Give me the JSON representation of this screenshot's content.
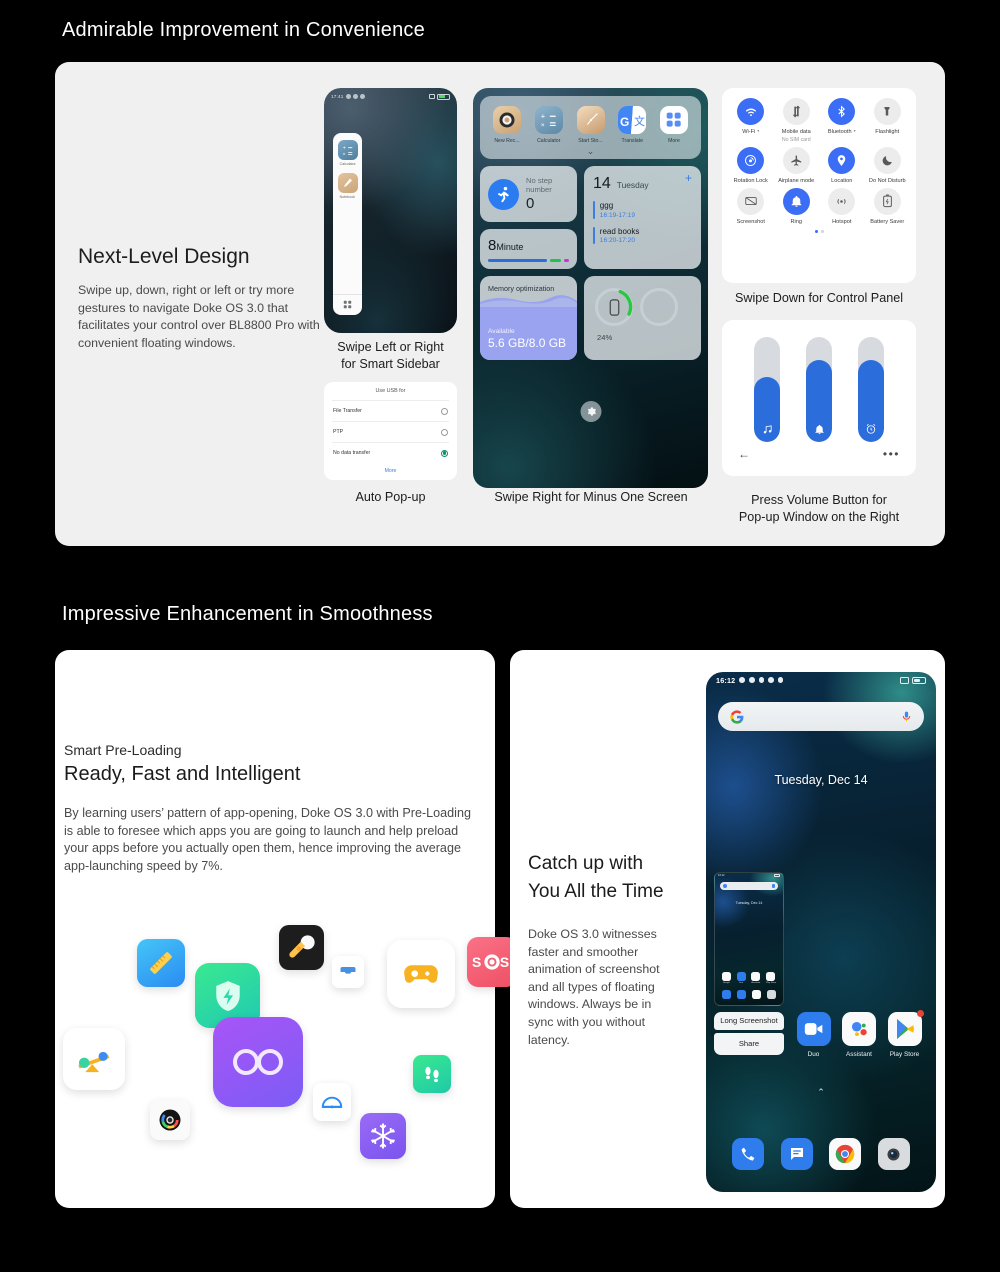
{
  "sections": {
    "one_title": "Admirable Improvement in Convenience",
    "two_title": "Impressive Enhancement in Smoothness"
  },
  "design": {
    "heading": "Next-Level Design",
    "body": "Swipe up, down, right or left or try more gestures to navigate Doke OS 3.0 that facilitates your control over BL8800 Pro with convenient floating windows."
  },
  "captions": {
    "sidebar": "Swipe Left or Right\nfor Smart Sidebar",
    "sidebar_l1": "Swipe Left or Right",
    "sidebar_l2": "for Smart Sidebar",
    "autopopup": "Auto Pop-up",
    "minus_one": "Swipe Right for Minus One Screen",
    "control_panel": "Swipe Down for Control Panel",
    "volume_l1": "Press Volume Button for",
    "volume_l2": "Pop-up Window on the Right"
  },
  "smart_sidebar": {
    "items": [
      {
        "label": "Calculator",
        "icon": "calculator-icon"
      },
      {
        "label": "Notebook",
        "icon": "notebook-icon"
      }
    ],
    "grid_icon": "app-grid-icon"
  },
  "usb_dialog": {
    "title": "Use USB for",
    "options": [
      {
        "label": "File Transfer",
        "selected": false
      },
      {
        "label": "PTP",
        "selected": false
      },
      {
        "label": "No data transfer",
        "selected": true
      }
    ],
    "more": "More"
  },
  "minus_one": {
    "apps": [
      {
        "label": "New Rec...",
        "icon": "recorder-icon"
      },
      {
        "label": "Calculator",
        "icon": "calculator-icon"
      },
      {
        "label": "Start Sto...",
        "icon": "stopwatch-icon"
      },
      {
        "label": "Translate",
        "icon": "translate-icon"
      },
      {
        "label": "More",
        "icon": "more-grid-icon"
      }
    ],
    "steps_widget": {
      "title": "No step number",
      "value": "0",
      "icon": "runner-icon"
    },
    "minute_widget": {
      "value": "8",
      "unit": "Minute"
    },
    "calendar_widget": {
      "day": "14",
      "weekday": "Tuesday",
      "add": "+",
      "events": [
        {
          "title": "ggg",
          "time": "16:19-17:19"
        },
        {
          "title": "read books",
          "time": "16:20-17:20"
        }
      ]
    },
    "memory_widget": {
      "title": "Memory optimization",
      "sub": "Available",
      "value": "5.6 GB/8.0 GB"
    },
    "battery_widget": {
      "percent": "24%",
      "icon": "battery-ring-icon"
    },
    "settings_icon": "gear-icon"
  },
  "control_panel": {
    "tiles": [
      {
        "label": "Wi-Fi",
        "sub": "",
        "on": true,
        "caret": true,
        "icon": "wifi-icon"
      },
      {
        "label": "Mobile data",
        "sub": "No SIM card",
        "on": false,
        "caret": false,
        "icon": "mobile-data-icon"
      },
      {
        "label": "Bluetooth",
        "sub": "",
        "on": true,
        "caret": true,
        "icon": "bluetooth-icon"
      },
      {
        "label": "Flashlight",
        "sub": "",
        "on": false,
        "caret": false,
        "icon": "flashlight-icon"
      },
      {
        "label": "Rotation Lock",
        "sub": "",
        "on": true,
        "caret": false,
        "icon": "rotation-lock-icon"
      },
      {
        "label": "Airplane mode",
        "sub": "",
        "on": false,
        "caret": false,
        "icon": "airplane-icon"
      },
      {
        "label": "Location",
        "sub": "",
        "on": true,
        "caret": false,
        "icon": "location-pin-icon"
      },
      {
        "label": "Do Not Disturb",
        "sub": "",
        "on": false,
        "caret": false,
        "icon": "moon-icon"
      },
      {
        "label": "Screenshot",
        "sub": "",
        "on": false,
        "caret": false,
        "icon": "screenshot-icon"
      },
      {
        "label": "Ring",
        "sub": "",
        "on": true,
        "caret": false,
        "icon": "bell-icon"
      },
      {
        "label": "Hotspot",
        "sub": "",
        "on": false,
        "caret": false,
        "icon": "hotspot-icon"
      },
      {
        "label": "Battery Saver",
        "sub": "",
        "on": false,
        "caret": false,
        "icon": "battery-saver-icon"
      }
    ]
  },
  "volume_panel": {
    "sliders": [
      {
        "name": "media",
        "icon": "music-note-icon",
        "fill_pct": 62
      },
      {
        "name": "ring",
        "icon": "bell-icon",
        "fill_pct": 78
      },
      {
        "name": "alarm",
        "icon": "alarm-clock-icon",
        "fill_pct": 78
      }
    ],
    "back_icon": "back-arrow-icon",
    "more_icon": "more-dots-icon"
  },
  "preloading": {
    "eyebrow": "Smart Pre-Loading",
    "heading": "Ready, Fast and Intelligent",
    "body": "By learning users’ pattern of app-opening, Doke OS 3.0 with Pre-Loading is able to foresee which apps you are going to launch and help preload your apps before you actually open them, hence improving the average app-launching speed by 7%.",
    "app_icons": [
      "ruler-icon",
      "shield-icon",
      "flashlight-icon",
      "inbox-icon",
      "gamepad-icon",
      "sos-icon",
      "level-balance-icon",
      "camera-icon",
      "infinity-loop-icon",
      "protractor-icon",
      "snowflake-icon",
      "footsteps-icon"
    ]
  },
  "catchup": {
    "heading_l1": "Catch up with",
    "heading_l2": "You All the Time",
    "body": "Doke OS 3.0 witnesses faster and smoother animation of screenshot and all types of floating windows. Always be in sync with you without latency."
  },
  "phone": {
    "status_time": "16:12",
    "date": "Tuesday, Dec 14",
    "search_placeholder": "",
    "google_icon": "google-g-icon",
    "mic_icon": "microphone-icon",
    "screenshot_actions": [
      {
        "label": "Long Screenshot"
      },
      {
        "label": "Share"
      }
    ],
    "apps": [
      {
        "label": "Duo",
        "icon": "duo-icon"
      },
      {
        "label": "Assistant",
        "icon": "assistant-icon"
      },
      {
        "label": "Play Store",
        "icon": "play-store-icon"
      }
    ],
    "dock": [
      {
        "label": "Phone",
        "icon": "phone-icon"
      },
      {
        "label": "Messages",
        "icon": "messages-icon"
      },
      {
        "label": "Chrome",
        "icon": "chrome-icon"
      },
      {
        "label": "Camera",
        "icon": "camera-icon"
      }
    ],
    "chevron_icon": "chevron-up-icon"
  },
  "colors": {
    "accent_blue": "#3b6ef5",
    "card_gray": "#f0f0f0",
    "card_white": "#ffffff",
    "background": "#000000"
  }
}
